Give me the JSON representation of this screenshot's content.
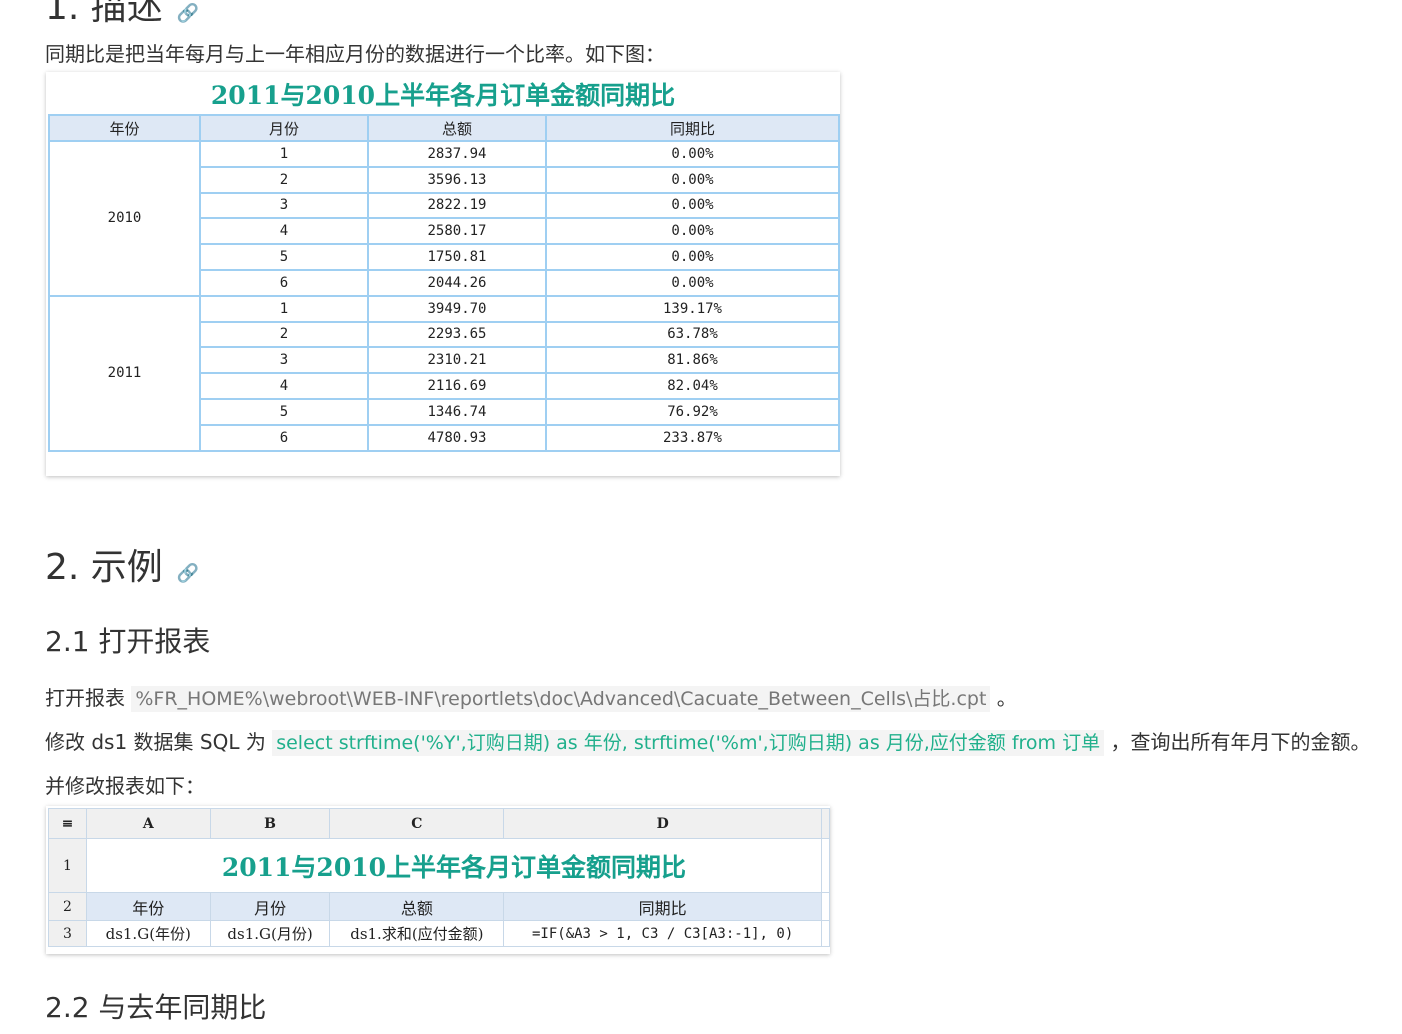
{
  "section1": {
    "heading": "1. 描述",
    "intro": "同期比是把当年每月与上一年相应月份的数据进行一个比率。如下图："
  },
  "figure1": {
    "title": "2011与2010上半年各月订单金额同期比",
    "headers": [
      "年份",
      "月份",
      "总额",
      "同期比"
    ],
    "groups": [
      {
        "year": "2010",
        "rows": [
          [
            "1",
            "2837.94",
            "0.00%"
          ],
          [
            "2",
            "3596.13",
            "0.00%"
          ],
          [
            "3",
            "2822.19",
            "0.00%"
          ],
          [
            "4",
            "2580.17",
            "0.00%"
          ],
          [
            "5",
            "1750.81",
            "0.00%"
          ],
          [
            "6",
            "2044.26",
            "0.00%"
          ]
        ]
      },
      {
        "year": "2011",
        "rows": [
          [
            "1",
            "3949.70",
            "139.17%"
          ],
          [
            "2",
            "2293.65",
            "63.78%"
          ],
          [
            "3",
            "2310.21",
            "81.86%"
          ],
          [
            "4",
            "2116.69",
            "82.04%"
          ],
          [
            "5",
            "1346.74",
            "76.92%"
          ],
          [
            "6",
            "4780.93",
            "233.87%"
          ]
        ]
      }
    ]
  },
  "section2": {
    "heading": "2. 示例",
    "sub1": "2.1 打开报表",
    "open_prefix": "打开报表",
    "open_path": "%FR_HOME%\\webroot\\WEB-INF\\reportlets\\doc\\Advanced\\Cacuate_Between_Cells\\占比.cpt",
    "open_suffix": "。",
    "modify_prefix": "修改 ds1 数据集 SQL 为",
    "sql": "select strftime('%Y',订购日期) as 年份, strftime('%m',订购日期) as 月份,应付金额 from 订单",
    "modify_suffix": "，查询出所有年月下的金额。",
    "modify_report": "并修改报表如下：",
    "sub2": "2.2 与去年同期比"
  },
  "figure2": {
    "corner": "≡",
    "columns": [
      "A",
      "B",
      "C",
      "D"
    ],
    "rownums": [
      "1",
      "2",
      "3"
    ],
    "title": "2011与2010上半年各月订单金额同期比",
    "headers": [
      "年份",
      "月份",
      "总额",
      "同期比"
    ],
    "cells": [
      "ds1.G(年份)",
      "ds1.G(月份)",
      "ds1.求和(应付金额)",
      "=IF(&A3 > 1, C3 / C3[A3:-1], 0)"
    ]
  },
  "icons": {
    "anchor": "link-icon"
  }
}
